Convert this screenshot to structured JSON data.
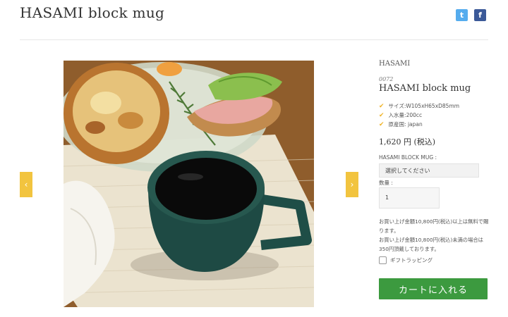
{
  "header": {
    "title": "HASAMI block mug",
    "social": [
      {
        "icon": "twitter-icon",
        "glyph": "t"
      },
      {
        "icon": "facebook-icon",
        "glyph": "f"
      }
    ]
  },
  "gallery": {
    "prev_glyph": "‹",
    "next_glyph": "›"
  },
  "product": {
    "brand": "HASAMI",
    "code": "0072",
    "name": "HASAMI block mug",
    "specs": [
      "サイズ:W105xH65xD85mm",
      "入水量:200cc",
      "原産国: japan"
    ],
    "price": "1,620 円 (税込)",
    "variant_label": "HASAMI BLOCK MUG :",
    "variant_value": "選択してください",
    "qty_label": "数量 :",
    "qty_value": "1",
    "notes": [
      "お買い上げ金額10,800円(税込)以上は無料で賜ります。",
      "お買い上げ金額10,800円(税込)未満の場合は350円頂戴しております。"
    ],
    "gift_label": "ギフトラッピング",
    "cart_label": "カートに入れる"
  },
  "colors": {
    "accent": "#f2c43f",
    "cart_button": "#3c9a3f",
    "check": "#f0b429",
    "twitter": "#55acee",
    "facebook": "#3b5998"
  }
}
